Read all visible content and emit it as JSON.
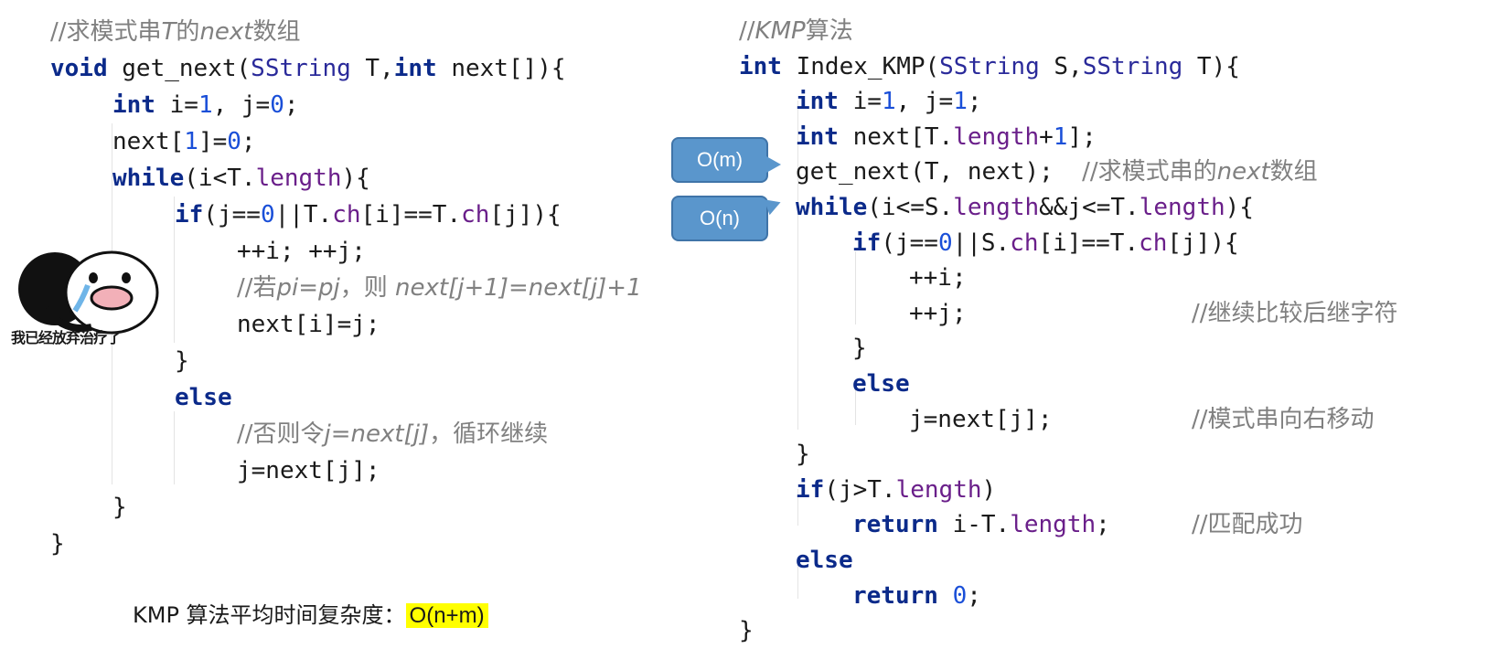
{
  "left_code": {
    "comment_title_a": "//求模式串",
    "comment_title_b": "T",
    "comment_title_c": "的",
    "comment_title_d": "next",
    "comment_title_e": "数组",
    "void": "void",
    "fn_name": " get_next(",
    "sstring": "SString",
    "param_t": " T,",
    "int_kw": "int",
    "param_next": " next[]){",
    "int_i_text_a": " i=",
    "one": "1",
    "int_i_text_b": ", j=",
    "zero": "0",
    "semi": ";",
    "next1_a": "next[",
    "next1_b": "]=",
    "while_kw": "while",
    "while_a": "(i<T.",
    "length": "length",
    "while_b": "){",
    "if_kw": "if",
    "if_a": "(j==",
    "if_b": "||T.",
    "ch": "ch",
    "if_c": "[i]==T.",
    "if_d": "[j]){",
    "incr": "++i; ++j;",
    "comment_if_a": "//若",
    "comment_if_b": "pi=pj",
    "comment_if_c": "，则 ",
    "comment_if_d": "next[j+1]=next[j]+1",
    "assign_next": "next[i]=j;",
    "close_brace": "}",
    "else_kw": "else",
    "comment_else_a": "//否则令",
    "comment_else_b": "j=next[j]",
    "comment_else_c": "，循环继续",
    "assign_j": "j=next[j];"
  },
  "right_code": {
    "title_a": "//",
    "title_b": "KMP",
    "title_c": "算法",
    "int_kw": "int",
    "fn_name": " Index_KMP(",
    "sstring": "SString",
    "param_s": " S,",
    "param_t": " T){",
    "init_a": " i=",
    "one": "1",
    "init_b": ", j=",
    "semi": ";",
    "arr_a": " next[T.",
    "length": "length",
    "arr_b": "+",
    "arr_c": "];",
    "call": "get_next(T, next);  ",
    "call_comment_a": "//求模式串的",
    "call_comment_b": "next",
    "call_comment_c": "数组",
    "while_kw": "while",
    "while_a": "(i<=S.",
    "while_b": "&&j<=T.",
    "while_c": "){",
    "if_kw": "if",
    "if_a": "(j==",
    "zero": "0",
    "if_b": "||S.",
    "ch": "ch",
    "if_c": "[i]==T.",
    "if_d": "[j]){",
    "inc_i": "++i;",
    "inc_j": "++j;",
    "comment_continue": "//继续比较后继字符",
    "close_brace": "}",
    "else_kw": "else",
    "assign_j": "j=next[j];",
    "comment_shift": "//模式串向右移动",
    "if2_a": "(j>T.",
    "if2_b": ")",
    "return_kw": "return",
    "return_a": " i-T.",
    "comment_match": "//匹配成功"
  },
  "callouts": {
    "om": "O(m)",
    "on": "O(n)"
  },
  "sticker": {
    "caption": "我已经放弃治疗了"
  },
  "summary": {
    "label": "KMP 算法平均时间复杂度：",
    "value": "O(n+m)"
  }
}
